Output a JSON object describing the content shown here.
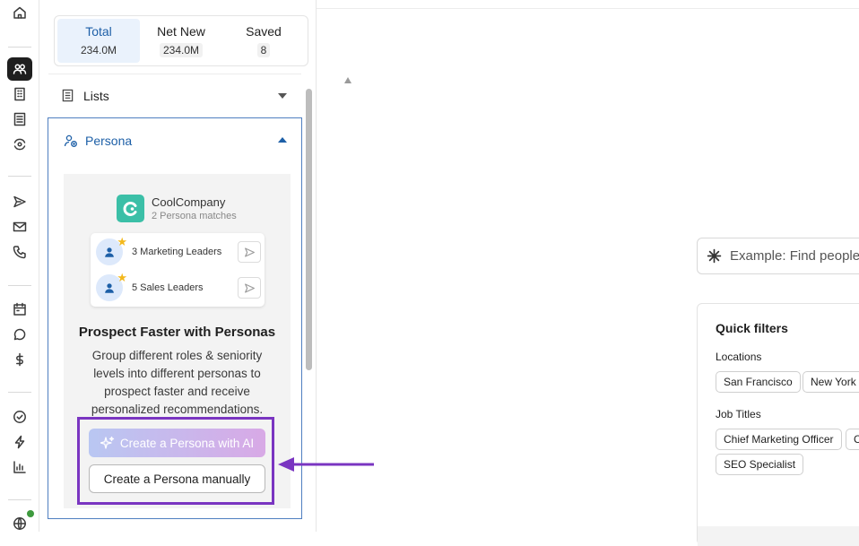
{
  "counts": [
    {
      "label": "Total",
      "value": "234.0M",
      "active": true
    },
    {
      "label": "Net New",
      "value": "234.0M",
      "active": false
    },
    {
      "label": "Saved",
      "value": "8",
      "active": false
    }
  ],
  "lists": {
    "label": "Lists"
  },
  "persona": {
    "label": "Persona",
    "company_name": "CoolCompany",
    "company_sub": "2 Persona matches",
    "rows": [
      {
        "label": "3 Marketing Leaders"
      },
      {
        "label": "5 Sales Leaders"
      }
    ],
    "title": "Prospect Faster with Personas",
    "description": "Group different roles & seniority levels into different personas to prospect faster and receive personalized recommendations.",
    "ai_button": "Create a Persona with AI",
    "manual_button": "Create a Persona manually"
  },
  "search": {
    "placeholder": "Example: Find people"
  },
  "quick_filters": {
    "title": "Quick filters",
    "locations_label": "Locations",
    "locations": [
      "San Francisco",
      "New York"
    ],
    "job_titles_label": "Job Titles",
    "job_titles": [
      "Chief Marketing Officer",
      "C",
      "SEO Specialist"
    ]
  },
  "colors": {
    "accent": "#1d5fa7",
    "highlight": "#7a35c1",
    "status_online": "#3e9a3e"
  },
  "rail_icons": [
    "home-icon",
    "people-icon",
    "building-icon",
    "list-icon",
    "sync-eye-icon",
    "send-icon",
    "mail-icon",
    "phone-icon",
    "calendar-icon",
    "chat-icon",
    "dollar-icon",
    "check-circle-icon",
    "bolt-icon",
    "bar-chart-icon",
    "globe-icon"
  ]
}
